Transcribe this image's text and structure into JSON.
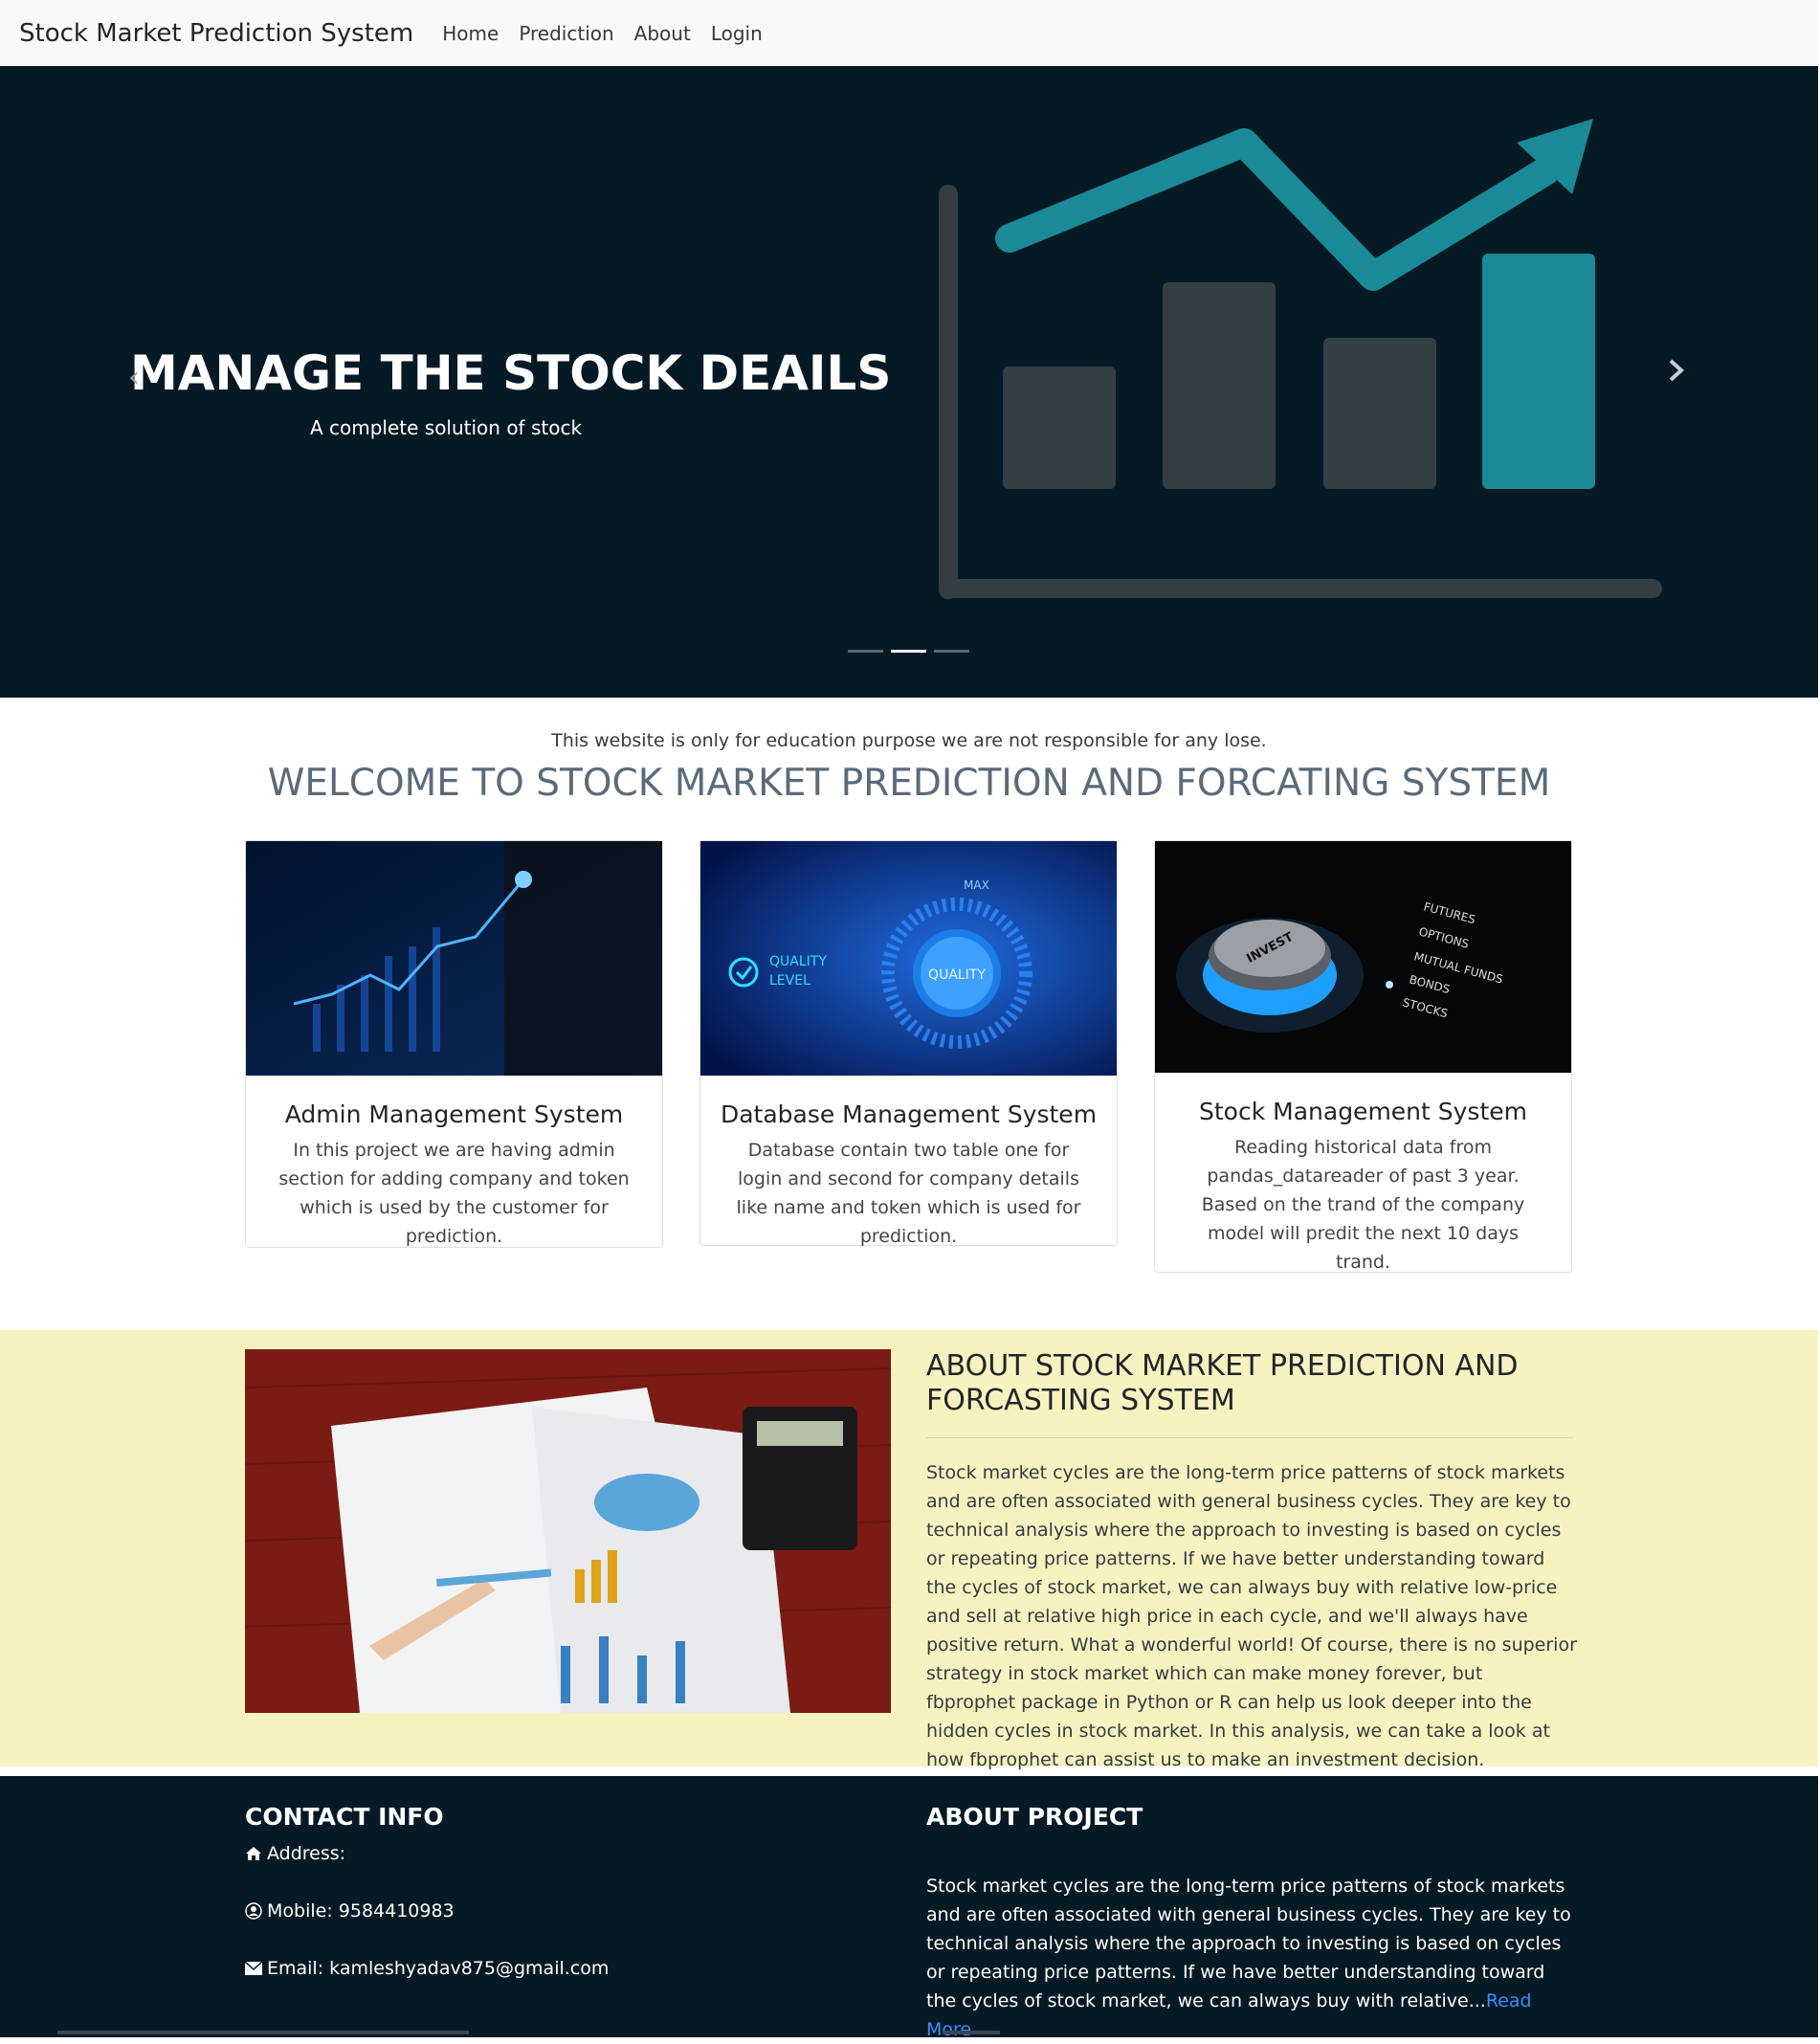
{
  "navbar": {
    "brand": "Stock Market Prediction System",
    "links": [
      "Home",
      "Prediction",
      "About",
      "Login"
    ]
  },
  "hero": {
    "title": "MANAGE THE STOCK DEAILS",
    "subtitle": "A complete solution of stock",
    "active_slide": 2,
    "slide_count": 3
  },
  "intro": {
    "disclaimer": "This website is only for education purpose we are not responsible for any lose.",
    "welcome": "WELCOME TO STOCK MARKET PREDICTION AND FORCATING SYSTEM"
  },
  "cards": [
    {
      "title": "Admin Management System",
      "text": "In this project we are having admin section for adding company and token which is used by the customer for prediction."
    },
    {
      "title": "Database Management System",
      "text": "Database contain two table one for login and second for company details like name and token which is used for prediction.",
      "image_labels": [
        "QUALITY LEVEL",
        "QUALITY",
        "MAX"
      ]
    },
    {
      "title": "Stock Management System",
      "text": "Reading historical data from pandas_datareader of past 3 year. Based on the trand of the company model will predit the next 10 days trand.",
      "image_labels": [
        "INVEST",
        "FUTURES",
        "OPTIONS",
        "MUTUAL FUNDS",
        "BONDS",
        "STOCKS"
      ]
    }
  ],
  "about": {
    "title": "ABOUT STOCK MARKET PREDICTION AND FORCASTING SYSTEM",
    "text": "Stock market cycles are the long-term price patterns of stock markets and are often associated with general business cycles. They are key to technical analysis where the approach to investing is based on cycles or repeating price patterns. If we have better understanding toward the cycles of stock market, we can always buy with relative low-price and sell at relative high price in each cycle, and we'll always have positive return. What a wonderful world! Of course, there is no superior strategy in stock market which can make money forever, but fbprophet package in Python or R can help us look deeper into the hidden cycles in stock market. In this analysis, we can take a look at how fbprophet can assist us to make an investment decision."
  },
  "footer": {
    "contact_title": "CONTACT INFO",
    "address": "Address:",
    "mobile": "Mobile: 9584410983",
    "email": "Email: kamleshyadav875@gmail.com",
    "project_title": "ABOUT PROJECT",
    "project_text": "Stock market cycles are the long-term price patterns of stock markets and are often associated with general business cycles. They are key to technical analysis where the approach to investing is based on cycles or repeating price patterns. If we have better understanding toward the cycles of stock market, we can always buy with relative...",
    "read_more": "Read More"
  },
  "colors": {
    "hero_bg": "#061a26",
    "teal": "#1a8a96",
    "about_bg": "#f7f3c1",
    "link": "#3d8bfd"
  }
}
